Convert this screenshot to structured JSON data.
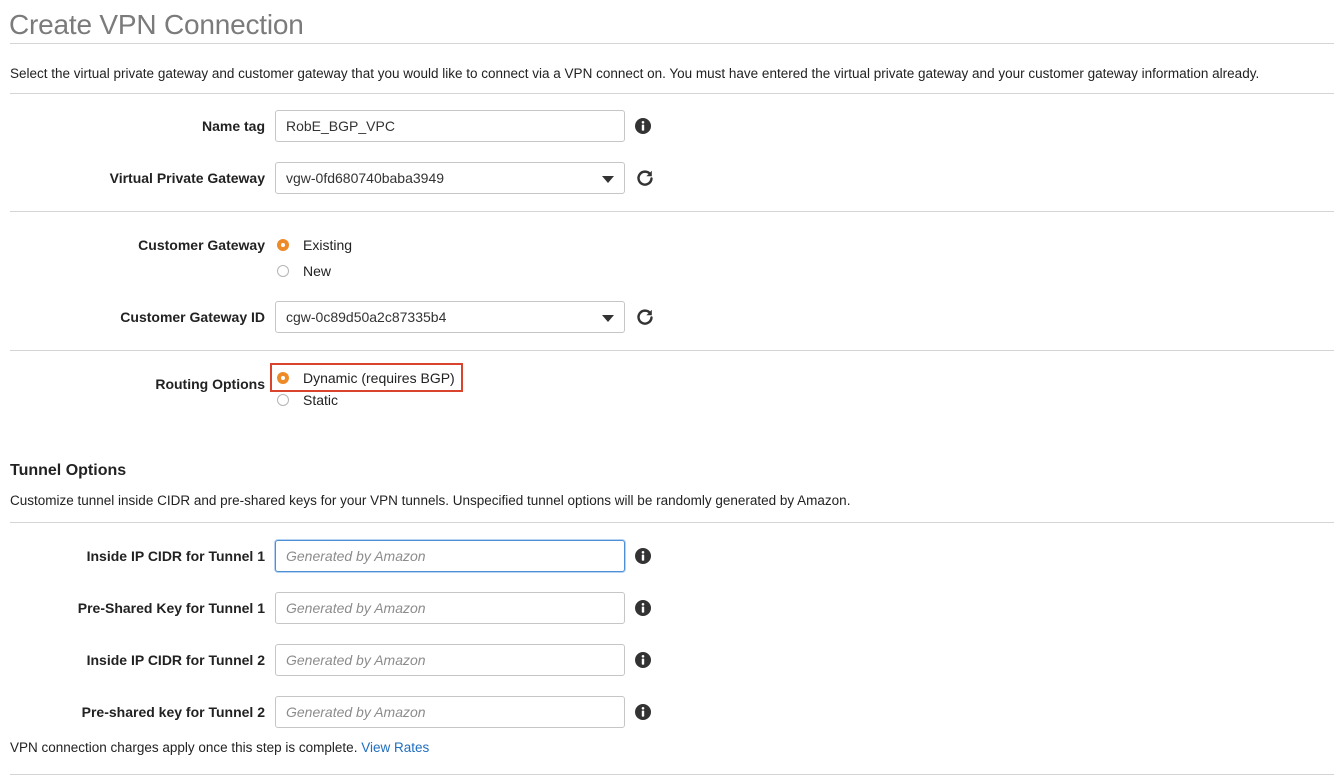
{
  "page": {
    "title": "Create VPN Connection",
    "description": "Select the virtual private gateway and customer gateway that you would like to connect via a VPN connect on. You must have entered the virtual private gateway and your customer gateway information already."
  },
  "form": {
    "name_tag": {
      "label": "Name tag",
      "value": "RobE_BGP_VPC"
    },
    "virtual_private_gateway": {
      "label": "Virtual Private Gateway",
      "selected": "vgw-0fd680740baba3949"
    },
    "customer_gateway": {
      "label": "Customer Gateway",
      "options": [
        {
          "label": "Existing",
          "checked": true
        },
        {
          "label": "New",
          "checked": false
        }
      ]
    },
    "customer_gateway_id": {
      "label": "Customer Gateway ID",
      "selected": "cgw-0c89d50a2c87335b4"
    },
    "routing_options": {
      "label": "Routing Options",
      "options": [
        {
          "label": "Dynamic (requires BGP)",
          "checked": true
        },
        {
          "label": "Static",
          "checked": false
        }
      ]
    }
  },
  "tunnel_options": {
    "heading": "Tunnel Options",
    "description": "Customize tunnel inside CIDR and pre-shared keys for your VPN tunnels. Unspecified tunnel options will be randomly generated by Amazon.",
    "fields": [
      {
        "label": "Inside IP CIDR for Tunnel 1",
        "placeholder": "Generated by Amazon"
      },
      {
        "label": "Pre-Shared Key for Tunnel 1",
        "placeholder": "Generated by Amazon"
      },
      {
        "label": "Inside IP CIDR for Tunnel 2",
        "placeholder": "Generated by Amazon"
      },
      {
        "label": "Pre-shared key for Tunnel 2",
        "placeholder": "Generated by Amazon"
      }
    ]
  },
  "footer": {
    "note": "VPN connection charges apply once this step is complete.",
    "link": "View Rates"
  },
  "colors": {
    "accent_radio": "#ec8b28",
    "highlight_border": "#d9442f",
    "link": "#1f6ebf",
    "focus_border": "#4f8fd6"
  },
  "icons": {
    "info": "info-icon",
    "refresh": "refresh-icon",
    "dropdown": "chevron-down-icon"
  }
}
